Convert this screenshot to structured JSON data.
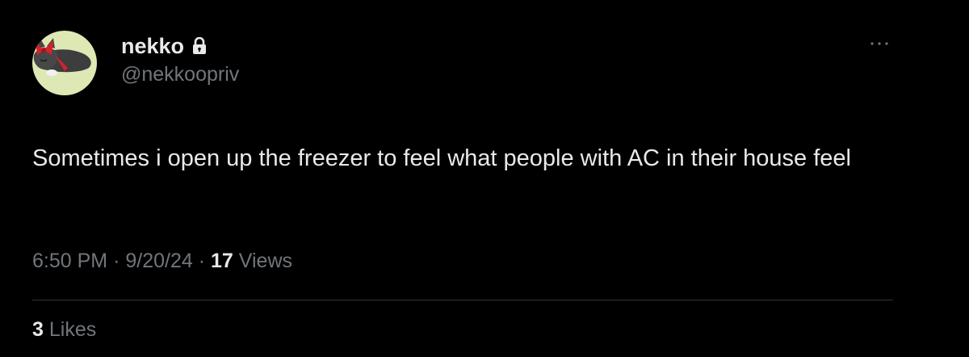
{
  "author": {
    "display_name": "nekko",
    "handle": "@nekkoopriv",
    "protected": true,
    "avatar_icon": "avatar-cat-icon"
  },
  "tweet": {
    "text": "Sometimes i open up the freezer to feel what people with AC in their house feel"
  },
  "meta": {
    "time": "6:50 PM",
    "separator": "·",
    "date": "9/20/24",
    "views_count": "17",
    "views_label": "Views"
  },
  "engagement": {
    "likes_count": "3",
    "likes_label": "Likes"
  },
  "colors": {
    "background": "#000000",
    "primary_text": "#e7e9ea",
    "secondary_text": "#71767b",
    "divider": "#2f3336",
    "avatar_bg": "#dde8b4"
  }
}
